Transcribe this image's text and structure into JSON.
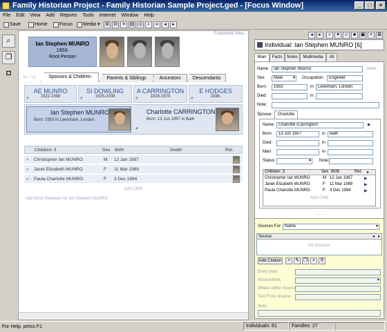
{
  "window": {
    "title": "Family Historian Project - Family Historian Sample Project.ged - [Focus Window]"
  },
  "menu": [
    "File",
    "Edit",
    "View",
    "Add",
    "Reports",
    "Tools",
    "Internet",
    "Window",
    "Help"
  ],
  "toolbar": {
    "save": "Save",
    "home": "Home",
    "focus": "Focus",
    "media": "Media"
  },
  "focus": {
    "customize": "Customize View...",
    "root": {
      "name": "Ian Stephen MUNRO",
      "years": "1953-",
      "role": "Root Person"
    },
    "tabs": [
      "Spouses & Children",
      "Parents & Siblings",
      "Ancestors",
      "Descendants"
    ],
    "parents": [
      {
        "name": "AE MUNRO",
        "dates": "1922-1998"
      },
      {
        "name": "SI DOWLING",
        "dates": "1925-2008"
      },
      {
        "name": "A CARRINGTON",
        "dates": "1924-1979"
      },
      {
        "name": "E HODGES",
        "dates": "1936-"
      }
    ],
    "person": {
      "name": "Ian Stephen MUNRO",
      "born": "Born:  1953 in Lewisham, London"
    },
    "spouse": {
      "name": "Charlotte CARRINGTON",
      "born": "Born:  13 Jun 1957 in Bath"
    },
    "children_header": {
      "children": "Children: 3",
      "sex": "Sex",
      "birth": "Birth",
      "death": "Death",
      "rel": "Rel."
    },
    "children": [
      {
        "name": "Christopher Ian MUNRO",
        "sex": "M",
        "birth": "12 Jan 1987"
      },
      {
        "name": "Janet Elizabeth MUNRO",
        "sex": "F",
        "birth": "11 Mar 1989"
      },
      {
        "name": "Paula Charlotte MUNRO",
        "sex": "F",
        "birth": "3 Dec 1994"
      }
    ],
    "add_child": "Add Child",
    "add_more": "Add More Relatives for Ian Stephen MUNRO"
  },
  "individual": {
    "header": "Individual: Ian Stephen MUNRO [6]",
    "tabs": [
      "Main",
      "Facts",
      "Notes",
      "Multimedia",
      "All"
    ],
    "labels": {
      "name": "Name:",
      "sex": "Sex:",
      "occupation": "Occupation:",
      "born": "Born:",
      "died": "Died:",
      "in": "in",
      "note": "Note:",
      "more": "more",
      "spouse": "Spouse:",
      "marr": "Marr:",
      "status": "Status:"
    },
    "name": "Ian Stephen /Munro/",
    "sex": "Male",
    "occupation": "Engineer",
    "born": "1953",
    "born_place": "Lewisham, London",
    "spouse_tab": "Charlotte",
    "spouse_detail": {
      "name": "Charlotte /Carrington/",
      "born": "13 Jun 1957",
      "born_place": "Bath"
    },
    "children_header": {
      "children": "Children: 3",
      "sex": "Sex",
      "birth": "Birth",
      "rel": "Rel."
    },
    "children": [
      {
        "name": "Christopher Ian MUNRO",
        "sex": "M",
        "birth": "12 Jan 1987"
      },
      {
        "name": "Janet Elizabeth MUNRO",
        "sex": "F",
        "birth": "11 Mar 1989"
      },
      {
        "name": "Paula Charlotte MUNRO",
        "sex": "F",
        "birth": "3 Dec 1994"
      }
    ],
    "add_child": "Add Child"
  },
  "sources": {
    "for_label": "Sources For:",
    "for_value": "Name",
    "col": "Source",
    "empty": "No Sources",
    "add_citation": "Add Citation",
    "fields": [
      "Entry Date:",
      "Assessment:",
      "Where within Source:",
      "Text From Source:",
      "Note:"
    ]
  },
  "status": {
    "help": "For Help, press F1",
    "individuals": "Individuals: 61",
    "families": "Families: 27"
  },
  "colors": {
    "title_bar": "#0a246a",
    "root_box": "#a6b7d6",
    "focus_box": "#c5d2e8",
    "source_panel": "#fefed4"
  }
}
